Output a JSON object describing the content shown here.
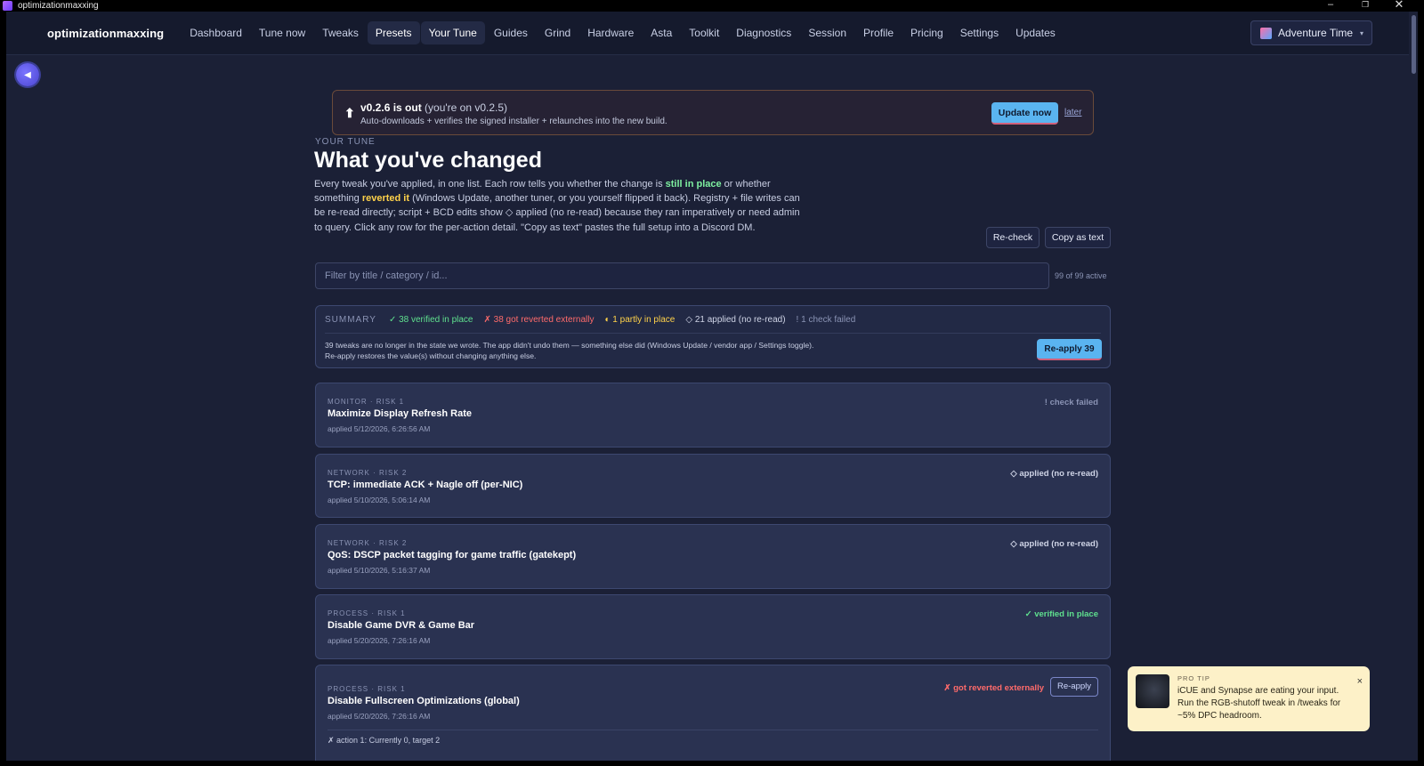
{
  "window": {
    "title": "optimizationmaxxing"
  },
  "nav": {
    "brand": "optimizationmaxxing",
    "items": [
      {
        "label": "Dashboard"
      },
      {
        "label": "Tune now"
      },
      {
        "label": "Tweaks"
      },
      {
        "label": "Presets"
      },
      {
        "label": "Your Tune"
      },
      {
        "label": "Guides"
      },
      {
        "label": "Grind"
      },
      {
        "label": "Hardware"
      },
      {
        "label": "Asta"
      },
      {
        "label": "Toolkit"
      },
      {
        "label": "Diagnostics"
      },
      {
        "label": "Session"
      },
      {
        "label": "Profile"
      },
      {
        "label": "Pricing"
      },
      {
        "label": "Settings"
      },
      {
        "label": "Updates"
      }
    ],
    "profile": "Adventure Time",
    "profile_caret": "▾"
  },
  "update": {
    "icon": "⬆",
    "version": "v0.2.6 is out",
    "current": "(you're on v0.2.5)",
    "detail": "Auto-downloads + verifies the signed installer + relaunches into the new build.",
    "button": "Update now",
    "later": "later"
  },
  "header": {
    "eyebrow": "YOUR TUNE",
    "title": "What you've changed",
    "intro_a": "Every tweak you've applied, in one list. Each row tells you whether the change is ",
    "intro_still": "still in place",
    "intro_b": " or whether something ",
    "intro_reverted": "reverted it",
    "intro_c": " (Windows Update, another tuner, or you yourself flipped it back). Registry + file writes can be re-read directly; script + BCD edits show ◇ applied (no re-read) because they ran imperatively or need admin to query. Click any row for the per-action detail. \"Copy as text\" pastes the full setup into a Discord DM.",
    "recheck": "Re-check",
    "copy": "Copy as text"
  },
  "filter": {
    "placeholder": "Filter by title / category / id...",
    "count": "99 of 99 active"
  },
  "summary": {
    "label": "SUMMARY",
    "verified": "✓ 38 verified in place",
    "reverted": "✗ 38 got reverted externally",
    "partly": "◐ 1 partly in place",
    "applied": "◇ 21 applied (no re-read)",
    "failed": "! 1 check failed",
    "text": "39 tweaks are no longer in the state we wrote. The app didn't undo them — something else did (Windows Update / vendor app / Settings toggle). Re-apply restores the value(s) without changing anything else.",
    "button": "Re-apply 39"
  },
  "cards": [
    {
      "meta": "MONITOR · RISK 1",
      "title": "Maximize Display Refresh Rate",
      "applied": "applied 5/12/2026, 6:26:56 AM",
      "status": "! check failed"
    },
    {
      "meta": "NETWORK · RISK 2",
      "title": "TCP: immediate ACK + Nagle off (per-NIC)",
      "applied": "applied 5/10/2026, 5:06:14 AM",
      "status": "◇ applied (no re-read)"
    },
    {
      "meta": "NETWORK · RISK 2",
      "title": "QoS: DSCP packet tagging for game traffic (gatekept)",
      "applied": "applied 5/10/2026, 5:16:37 AM",
      "status": "◇ applied (no re-read)"
    },
    {
      "meta": "PROCESS · RISK 1",
      "title": "Disable Game DVR & Game Bar",
      "applied": "applied 5/20/2026, 7:26:16 AM",
      "status": "✓ verified in place"
    },
    {
      "meta": "PROCESS · RISK 1",
      "title": "Disable Fullscreen Optimizations (global)",
      "applied": "applied 5/20/2026, 7:26:16 AM",
      "status": "✗ got reverted externally",
      "reapply": "Re-apply",
      "action": "✗ action 1: Currently 0, target 2"
    }
  ],
  "toast": {
    "eyebrow": "PRO TIP",
    "message": "iCUE and Synapse are eating your input. Run the RGB-shutoff tweak in /tweaks for ~5% DPC headroom.",
    "close": "×"
  },
  "colors": {
    "accent": "#5ab4f0",
    "verified": "#5fe08e",
    "reverted": "#ff6b6b",
    "partly": "#ffd24a",
    "background": "#1b2036"
  }
}
